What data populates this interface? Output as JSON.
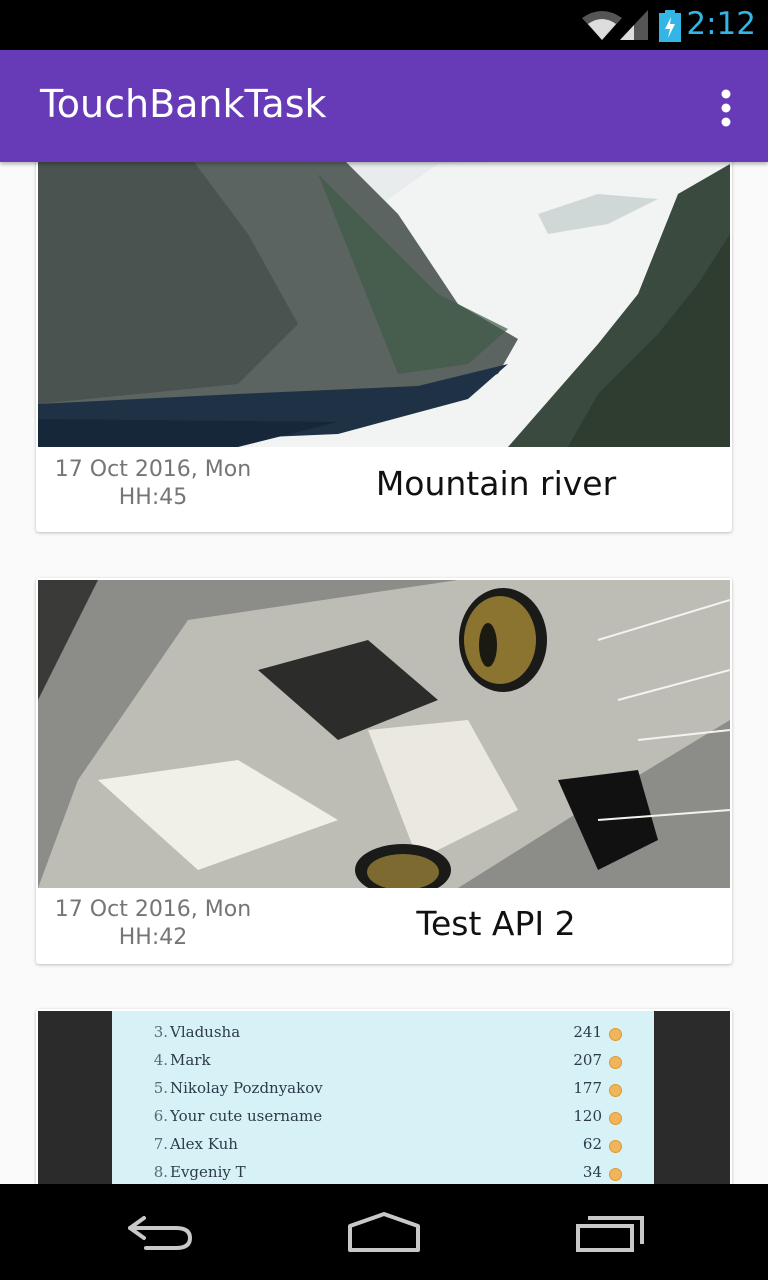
{
  "status_bar": {
    "time": "2:12"
  },
  "app_bar": {
    "title": "TouchBankTask"
  },
  "cards": [
    {
      "date": "17 Oct 2016, Mon",
      "time": "HH:45",
      "caption": "Mountain river"
    },
    {
      "date": "17 Oct 2016, Mon",
      "time": "HH:42",
      "caption": "Test API 2"
    }
  ],
  "leaderboard": {
    "rows": [
      {
        "rank": "3.",
        "name": "Vladusha",
        "score": "241"
      },
      {
        "rank": "4.",
        "name": "Mark",
        "score": "207"
      },
      {
        "rank": "5.",
        "name": "Nikolay Pozdnyakov",
        "score": "177"
      },
      {
        "rank": "6.",
        "name": "Your cute username",
        "score": "120"
      },
      {
        "rank": "7.",
        "name": "Alex Kuh",
        "score": "62"
      },
      {
        "rank": "8.",
        "name": "Evgeniy T",
        "score": "34"
      }
    ]
  },
  "colors": {
    "app_bar": "#673ab7",
    "status_time": "#33b5e5",
    "background": "#fafafa"
  },
  "icons": [
    "wifi-icon",
    "cell-signal-icon",
    "battery-icon",
    "overflow-menu-icon",
    "back-icon",
    "home-icon",
    "recents-icon"
  ]
}
